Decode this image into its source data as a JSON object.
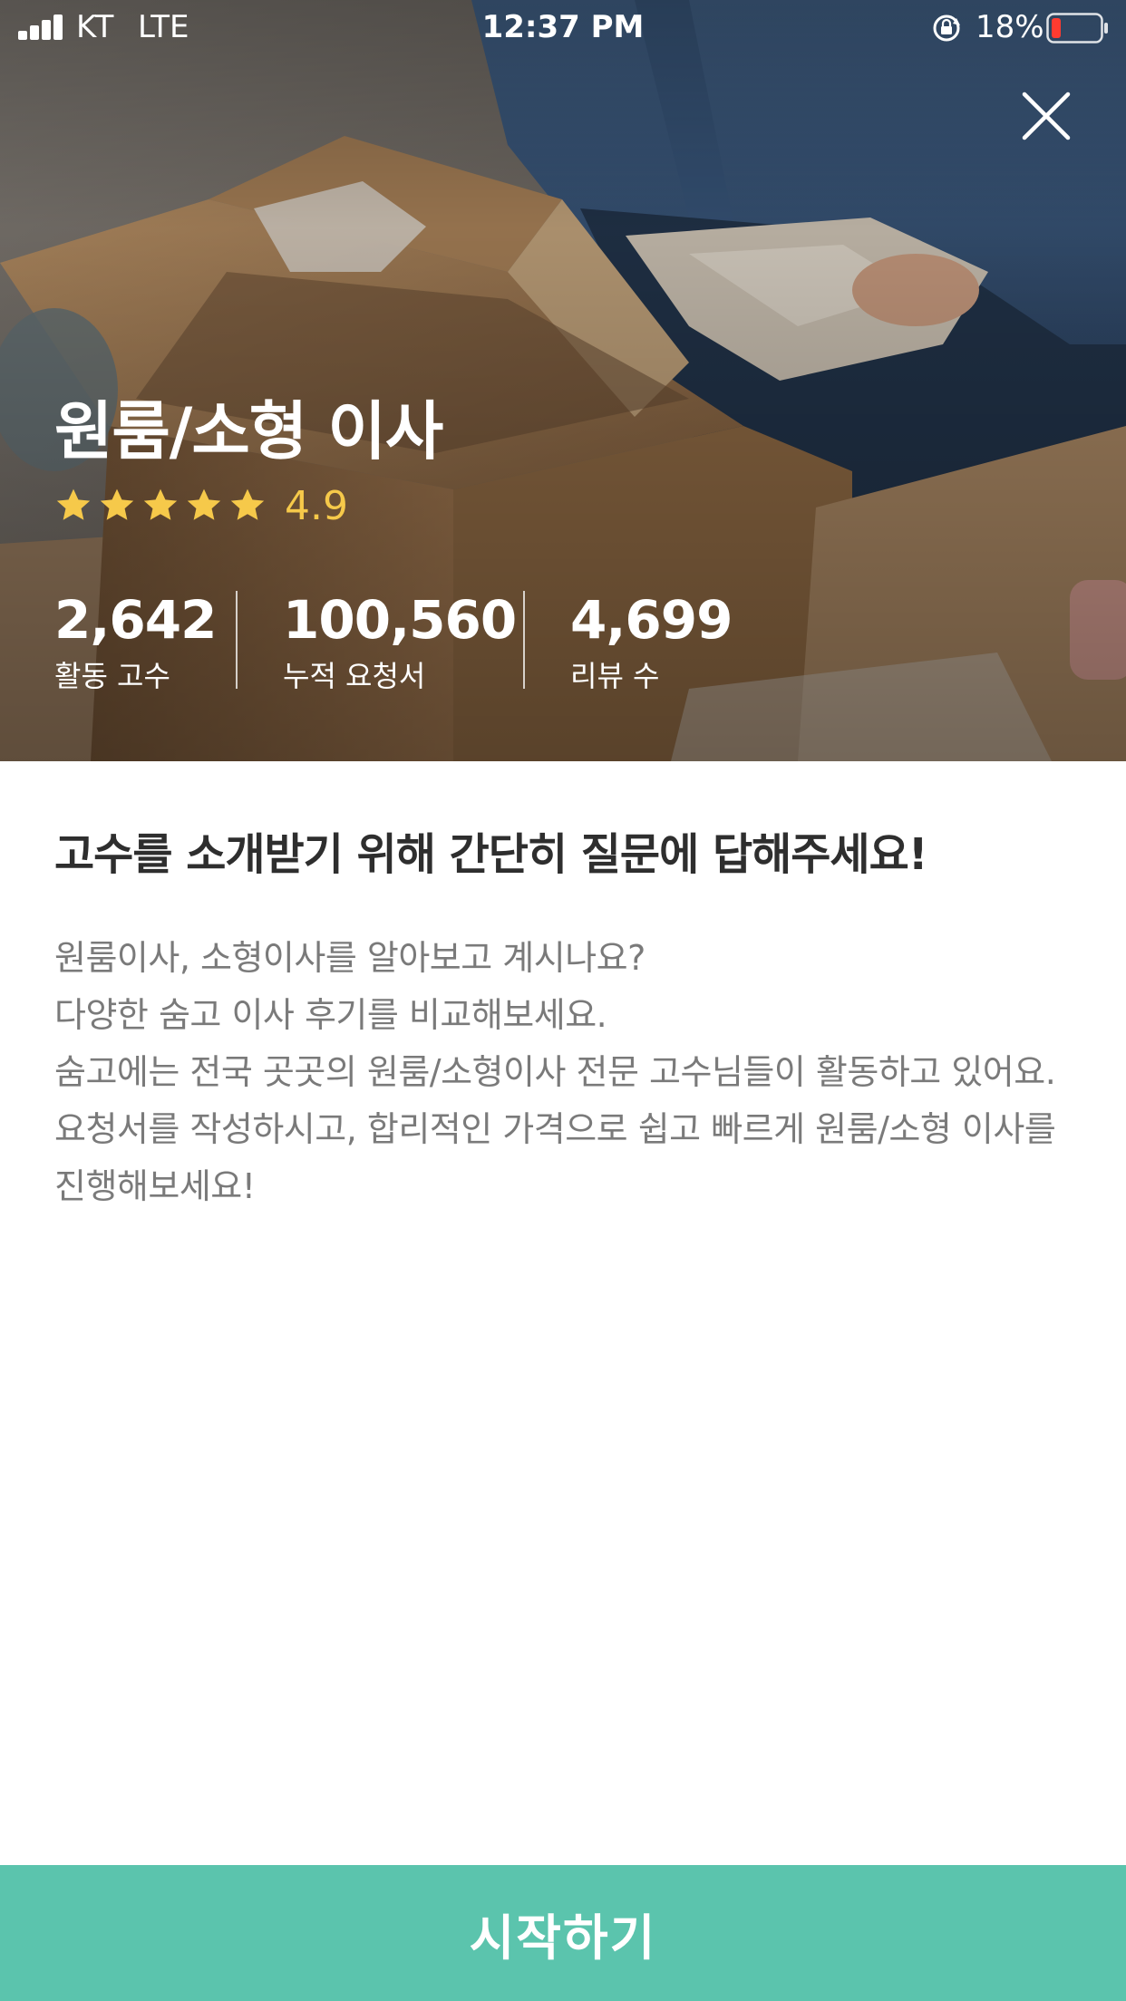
{
  "status_bar": {
    "carrier": "KT",
    "network": "LTE",
    "time": "12:37 PM",
    "battery": "18%"
  },
  "hero": {
    "title": "원룸/소형 이사",
    "rating": {
      "value": "4.9",
      "stars": 5,
      "star_color": "#f6c94a"
    },
    "stats": [
      {
        "value": "2,642",
        "label": "활동 고수"
      },
      {
        "value": "100,560",
        "label": "누적 요청서"
      },
      {
        "value": "4,699",
        "label": "리뷰 수"
      }
    ]
  },
  "intro": {
    "headline": "고수를 소개받기 위해 간단히 질문에 답해주세요!",
    "lines": [
      "원룸이사, 소형이사를 알아보고 계시나요?",
      "다양한 숨고 이사 후기를 비교해보세요.",
      "숨고에는 전국 곳곳의 원룸/소형이사 전문 고수님들이 활동하고 있어요. 요청서를 작성하시고, 합리적인 가격으로 쉽고 빠르게 원룸/소형 이사를 진행해보세요!"
    ]
  },
  "cta": {
    "label": "시작하기",
    "color": "#5bc4ad"
  },
  "icons": {
    "close": "close-icon",
    "star": "star-icon",
    "signal": "signal-icon",
    "lock": "rotation-lock-icon",
    "battery": "battery-icon"
  }
}
